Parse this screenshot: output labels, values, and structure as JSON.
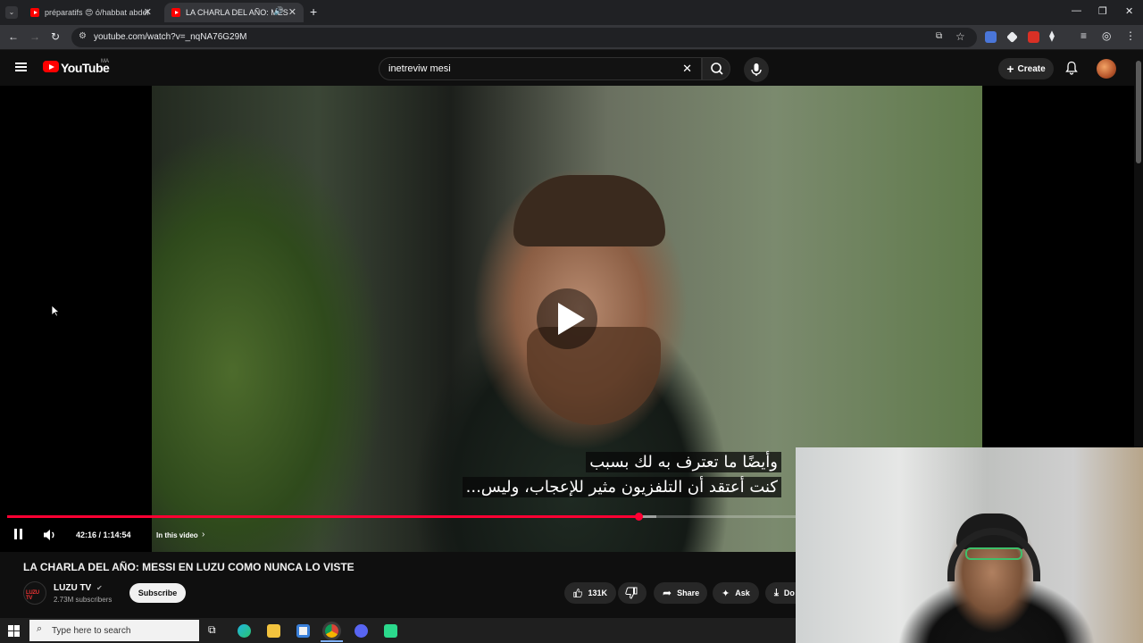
{
  "browser": {
    "tabs": [
      {
        "label": "préparatifs 😍 ό/habbat abdel"
      },
      {
        "label": "LA CHARLA DEL AÑO: MES"
      }
    ],
    "url": "youtube.com/watch?v=_nqNA76G29M"
  },
  "youtube": {
    "logo_text": "YouTube",
    "country_code": "MA",
    "search_query": "inetreviw mesi",
    "create_label": "Create"
  },
  "player": {
    "subtitle_line1": "وأيضًا ما تعترف به لك بسبب",
    "subtitle_line2": "كنت أعتقد أن التلفزيون مثير للإعجاب، وليس...",
    "time": "42:16 / 1:14:54",
    "chapter": "In this video",
    "progress_fraction": 0.564,
    "buffered_fraction": 0.58
  },
  "video": {
    "title": "LA CHARLA DEL AÑO: MESSI EN LUZU COMO NUNCA LO VISTE",
    "channel_name": "LUZU TV",
    "channel_avatar_text": "LUZU TV",
    "subscribers": "2.73M subscribers",
    "subscribe_label": "Subscribe",
    "likes": "131K",
    "share_label": "Share",
    "ask_label": "Ask",
    "download_label": "Do"
  },
  "taskbar": {
    "search_placeholder": "Type here to search"
  },
  "colors": {
    "accent_red": "#ff0033",
    "bg": "#0f0f0f"
  }
}
